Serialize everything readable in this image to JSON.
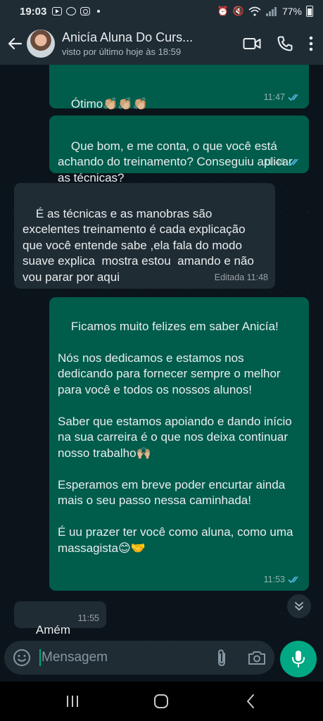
{
  "status_bar": {
    "time": "19:03",
    "battery": "77%"
  },
  "header": {
    "contact_name": "Anicía Aluna Do Curs...",
    "contact_status": "visto por último hoje às 18:59"
  },
  "messages": [
    {
      "id": "m1",
      "direction": "out",
      "text": "Ótimo👏🏼👏🏼👏🏼",
      "time": "11:47",
      "read": true
    },
    {
      "id": "m2",
      "direction": "out",
      "text": "Que bom, e me conta, o que você está achando do treinamento? Conseguiu aplicar as técnicas?",
      "time": "11:48",
      "read": true
    },
    {
      "id": "m3",
      "direction": "in",
      "text": "É as técnicas e as manobras são excelentes treinamento é cada explicação que você entende sabe ,ela fala do modo suave explica  mostra estou  amando e não vou parar por aqui",
      "time": "Editada 11:48"
    },
    {
      "id": "m4",
      "direction": "out",
      "text": "Ficamos muito felizes em saber Anicía!\n\nNós nos dedicamos e estamos nos dedicando para fornecer sempre o melhor para você e todos os nossos alunos!\n\nSaber que estamos apoiando e dando início na sua carreira é o que nos deixa continuar nosso trabalho🙌🏼\n\nEsperamos em breve poder encurtar ainda mais o seu passo nessa caminhada!\n\nÉ uu prazer ter você como aluna, como uma massagista😊🤝",
      "time": "11:53",
      "read": true
    },
    {
      "id": "m5",
      "direction": "in",
      "text": "Amém",
      "time": "11:55"
    }
  ],
  "composer": {
    "placeholder": "Mensagem"
  },
  "colors": {
    "outgoing": "#005c4b",
    "incoming": "#202c33",
    "accent": "#00a884",
    "read_ticks": "#53bdeb"
  },
  "icons": {
    "status": [
      "youtube-icon",
      "facebook-icon",
      "instagram-icon",
      "alarm-icon",
      "mute-icon",
      "wifi-icon",
      "signal-icon",
      "battery-icon"
    ],
    "header": [
      "back-arrow-icon",
      "video-call-icon",
      "phone-icon",
      "more-options-icon"
    ],
    "composer": [
      "emoji-icon",
      "attach-icon",
      "camera-icon",
      "mic-icon"
    ],
    "nav": [
      "recent-apps-icon",
      "home-icon",
      "back-icon"
    ]
  }
}
